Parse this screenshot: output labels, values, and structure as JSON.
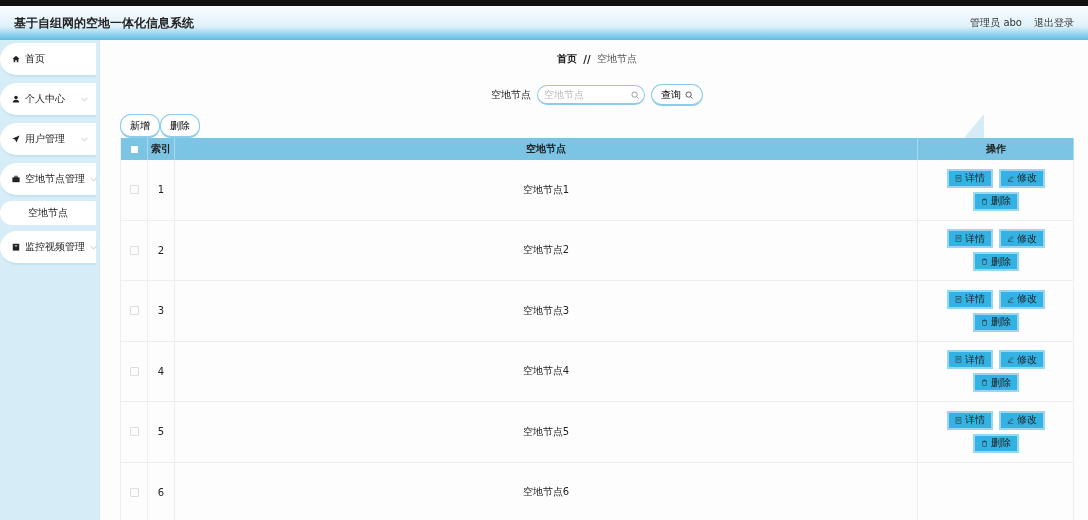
{
  "header": {
    "title": "基于自组网的空地一体化信息系统",
    "user": "管理员 abo",
    "logout": "退出登录"
  },
  "sidebar": {
    "items": [
      {
        "label": "首页",
        "kind": "home",
        "expandable": false
      },
      {
        "label": "个人中心",
        "kind": "user",
        "expandable": true
      },
      {
        "label": "用户管理",
        "kind": "send",
        "expandable": true
      },
      {
        "label": "空地节点管理",
        "kind": "briefcase",
        "expandable": true,
        "children": [
          {
            "label": "空地节点",
            "selected": true
          }
        ]
      },
      {
        "label": "监控视频管理",
        "kind": "box",
        "expandable": true
      }
    ]
  },
  "breadcrumb": {
    "home": "首页",
    "separator": "//",
    "current": "空地节点"
  },
  "search": {
    "label": "空地节点",
    "placeholder": "空地节点",
    "button": "查询"
  },
  "toolbar": [
    "新增",
    "删除"
  ],
  "table": {
    "columns": [
      "索引",
      "空地节点",
      "操作"
    ],
    "header_checked": false,
    "rows": [
      {
        "index": "1",
        "name": "空地节点1",
        "checked": false,
        "actions": [
          {
            "kind": "detail",
            "label": "详情"
          },
          {
            "kind": "edit",
            "label": "修改"
          },
          {
            "kind": "delete",
            "label": "删除"
          }
        ]
      },
      {
        "index": "2",
        "name": "空地节点2",
        "checked": false,
        "actions": [
          {
            "kind": "detail",
            "label": "详情"
          },
          {
            "kind": "edit",
            "label": "修改"
          },
          {
            "kind": "delete",
            "label": "删除"
          }
        ]
      },
      {
        "index": "3",
        "name": "空地节点3",
        "checked": false,
        "actions": [
          {
            "kind": "detail",
            "label": "详情"
          },
          {
            "kind": "edit",
            "label": "修改"
          },
          {
            "kind": "delete",
            "label": "删除"
          }
        ]
      },
      {
        "index": "4",
        "name": "空地节点4",
        "checked": false,
        "actions": [
          {
            "kind": "detail",
            "label": "详情"
          },
          {
            "kind": "edit",
            "label": "修改"
          },
          {
            "kind": "delete",
            "label": "删除"
          }
        ]
      },
      {
        "index": "5",
        "name": "空地节点5",
        "checked": false,
        "actions": [
          {
            "kind": "detail",
            "label": "详情"
          },
          {
            "kind": "edit",
            "label": "修改"
          },
          {
            "kind": "delete",
            "label": "删除"
          }
        ]
      },
      {
        "index": "6",
        "name": "空地节点6",
        "checked": false
      }
    ]
  }
}
